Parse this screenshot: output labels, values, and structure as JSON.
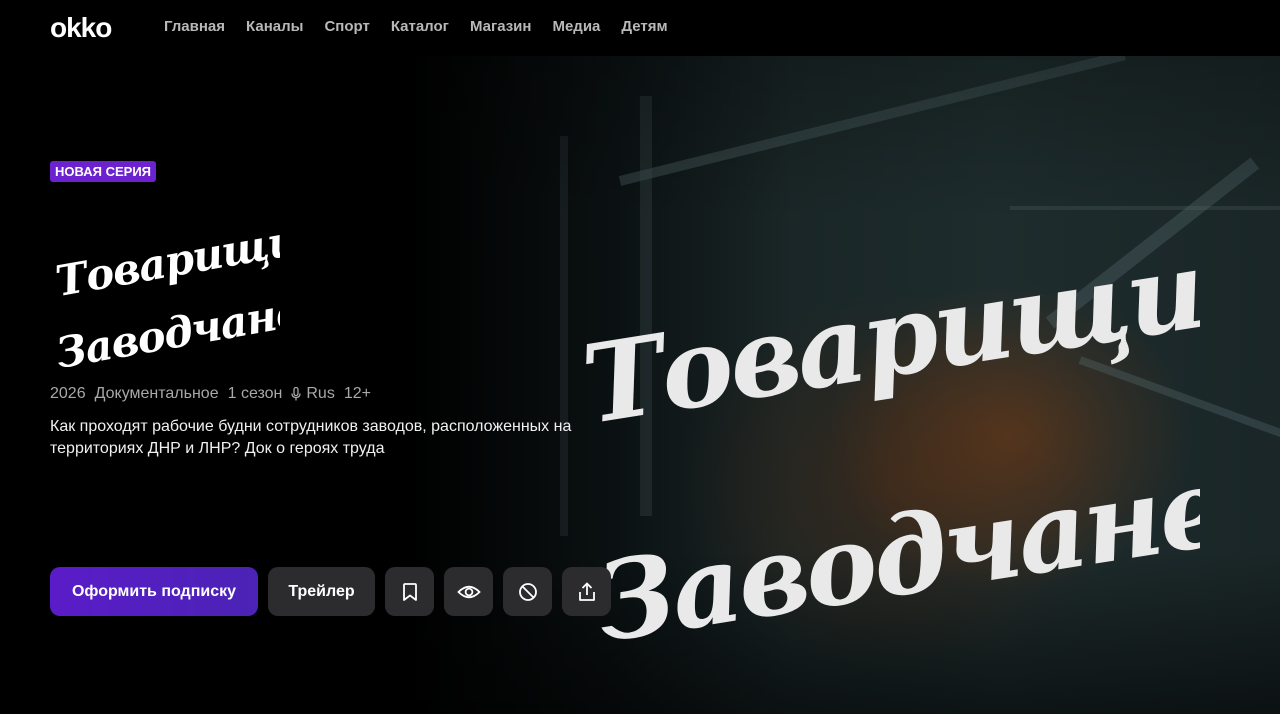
{
  "header": {
    "logo": "okko",
    "nav": [
      "Главная",
      "Каналы",
      "Спорт",
      "Каталог",
      "Магазин",
      "Медиа",
      "Детям"
    ]
  },
  "hero": {
    "badge": "НОВАЯ СЕРИЯ",
    "title_line1": "Товарищи,",
    "title_line2": "Заводчане!",
    "meta": {
      "year": "2026",
      "genre": "Документальное",
      "season": "1 сезон",
      "audio": "Rus",
      "age": "12+"
    },
    "description": "Как проходят рабочие будни сотрудников заводов, расположенных на территориях ДНР и ЛНР? Док о героях труда",
    "actions": {
      "subscribe": "Оформить подписку",
      "trailer": "Трейлер",
      "icons": [
        "bookmark-icon",
        "eye-icon",
        "block-icon",
        "share-icon"
      ]
    }
  },
  "colors": {
    "accent": "#6c22cf",
    "primary_button": "#5a1cc8",
    "secondary_button": "#2c2c2e"
  }
}
